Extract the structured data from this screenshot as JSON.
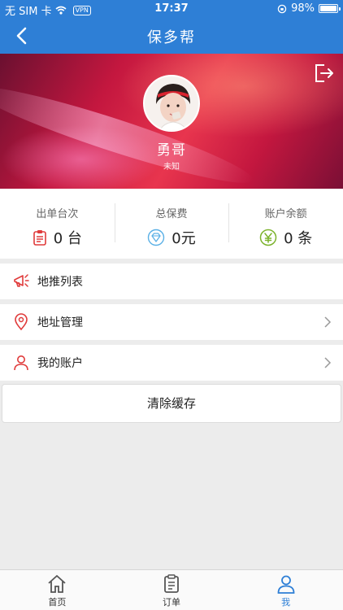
{
  "status_bar": {
    "carrier": "无 SIM 卡",
    "vpn": "VPN",
    "time": "17:37",
    "battery": "98%",
    "battery_level": 0.98
  },
  "nav": {
    "title": "保多帮"
  },
  "profile": {
    "name": "勇哥",
    "gender": "未知"
  },
  "stats": [
    {
      "label": "出单台次",
      "value": "0 台",
      "icon": "clipboard-icon",
      "color": "#e03b3b"
    },
    {
      "label": "总保费",
      "value": "0元",
      "icon": "diamond-icon",
      "color": "#5ab0e6"
    },
    {
      "label": "账户余额",
      "value": "0 条",
      "icon": "yen-icon",
      "color": "#7cb32d"
    }
  ],
  "menu": [
    {
      "label": "地推列表",
      "icon": "megaphone-icon"
    },
    {
      "label": "地址管理",
      "icon": "location-pin-icon"
    },
    {
      "label": "我的账户",
      "icon": "user-icon"
    }
  ],
  "clear_cache": "清除缓存",
  "tabs": [
    {
      "label": "首页",
      "icon": "home-icon"
    },
    {
      "label": "订单",
      "icon": "orders-icon"
    },
    {
      "label": "我",
      "icon": "profile-icon",
      "active": true
    }
  ],
  "colors": {
    "primary": "#2e7fd6",
    "red": "#e03b3b",
    "cyan": "#5ab0e6",
    "green": "#7cb32d"
  }
}
